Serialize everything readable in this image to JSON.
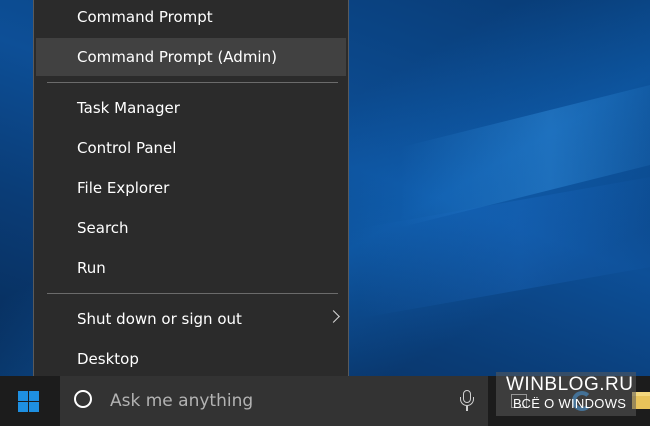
{
  "menu": {
    "items": [
      {
        "label": "Command Prompt",
        "highlighted": false
      },
      {
        "label": "Command Prompt (Admin)",
        "highlighted": true
      },
      {
        "label": "Task Manager",
        "highlighted": false
      },
      {
        "label": "Control Panel",
        "highlighted": false
      },
      {
        "label": "File Explorer",
        "highlighted": false
      },
      {
        "label": "Search",
        "highlighted": false
      },
      {
        "label": "Run",
        "highlighted": false
      },
      {
        "label": "Shut down or sign out",
        "highlighted": false,
        "submenu": true
      },
      {
        "label": "Desktop",
        "highlighted": false
      }
    ]
  },
  "taskbar": {
    "search_placeholder": "Ask me anything",
    "icons": [
      "windows-start-icon",
      "cortana-icon",
      "microphone-icon",
      "task-view-icon",
      "edge-icon",
      "file-explorer-icon"
    ]
  },
  "watermark": {
    "title": "WINBLOG.RU",
    "subtitle": "ВСЁ О WINDOWS"
  },
  "colors": {
    "menu_bg": "#2b2b2b",
    "menu_highlight": "#414141",
    "taskbar_bg": "#1c1c1c",
    "search_bg": "#333333",
    "accent": "#1e8fe0"
  }
}
